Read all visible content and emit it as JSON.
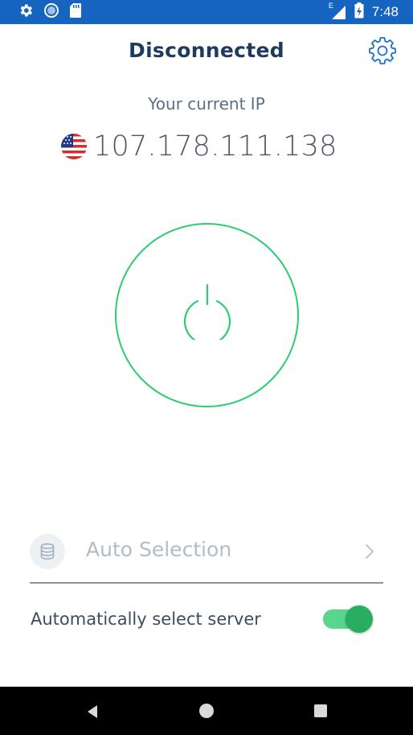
{
  "status_bar": {
    "time": "7:48",
    "network_type": "E",
    "icons": [
      "gear-icon",
      "circle-icon",
      "sd-card-icon",
      "signal-icon",
      "battery-icon"
    ]
  },
  "header": {
    "title": "Disconnected",
    "settings_icon": "gear-icon"
  },
  "ip": {
    "label": "Your current IP",
    "address": "107.178.111.138",
    "country_flag": "us-flag-icon"
  },
  "power": {
    "state": "off",
    "ring_color": "#2ecc71",
    "icon": "power-icon"
  },
  "server": {
    "label": "Auto Selection",
    "icon": "database-icon"
  },
  "auto_select": {
    "label": "Automatically select server",
    "enabled": true
  },
  "colors": {
    "status_bar": "#1565c0",
    "title": "#1f3a5f",
    "accent_green": "#2ecc71",
    "toggle_knob": "#27ae60"
  }
}
